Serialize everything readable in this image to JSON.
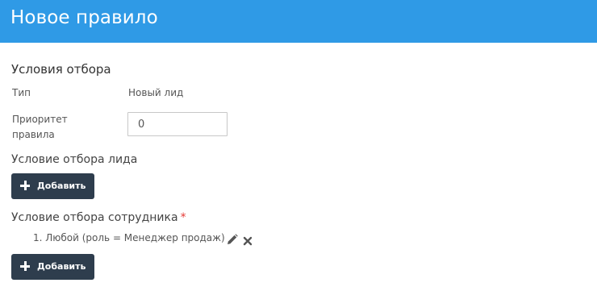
{
  "header": {
    "title": "Новое правило"
  },
  "conditions": {
    "title": "Условия отбора",
    "type_label": "Тип",
    "type_value": "Новый лид",
    "priority_label_line1": "Приоритет",
    "priority_label_line2": "правила",
    "priority_value": "0"
  },
  "lead_condition": {
    "title": "Условие отбора лида",
    "add_label": "Добавить"
  },
  "employee_condition": {
    "title": "Условие отбора сотрудника",
    "required_mark": "*",
    "items": [
      {
        "text": "1. Любой (роль = Менеджер продаж)",
        "edit_icon": "pencil-icon",
        "delete_icon": "close-icon"
      }
    ],
    "add_label": "Добавить"
  },
  "colors": {
    "header_bg": "#2f9ae6",
    "button_bg": "#2e3d4d",
    "required": "#e53935"
  }
}
